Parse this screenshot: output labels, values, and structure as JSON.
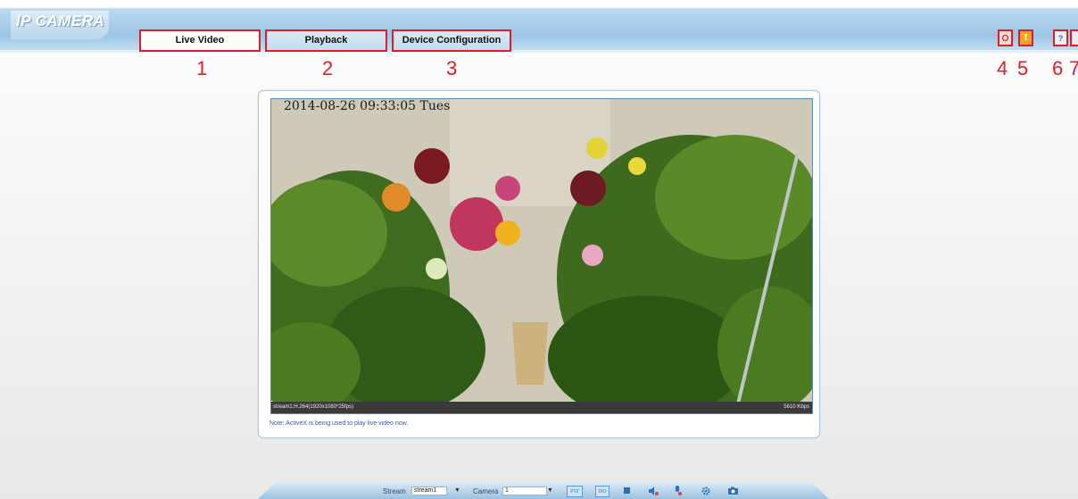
{
  "header": {
    "logo": "IP CAMERA",
    "tabs": [
      {
        "label": "Live Video",
        "number": "1"
      },
      {
        "label": "Playback",
        "number": "2"
      },
      {
        "label": "Device Configuration",
        "number": "3"
      }
    ],
    "right_icons": [
      {
        "name": "alarm-icon",
        "number": "4"
      },
      {
        "name": "warning-icon",
        "number": "5"
      },
      {
        "name": "help-icon",
        "number": "6"
      },
      {
        "name": "logout-icon",
        "number": "7"
      }
    ]
  },
  "video": {
    "osd_time": "2014-08-26 09:33:05 Tues",
    "stream_info": "stream1:H.264(1920x1080*25fps)",
    "bitrate": "5610 Kbps"
  },
  "note": "Note: ActiveX is being used to play live video now.",
  "toolbar": {
    "stream_label": "Stream",
    "stream_value": "stream1",
    "camera_label": "Camera",
    "camera_value": "1",
    "buttons": [
      "PTZ",
      "DIO",
      "stop",
      "audio",
      "mic",
      "settings",
      "snapshot"
    ]
  },
  "colors": {
    "annotation_red": "#e51c23",
    "header_blue": "#9cc6e6",
    "note_blue": "#2c5ea8"
  }
}
